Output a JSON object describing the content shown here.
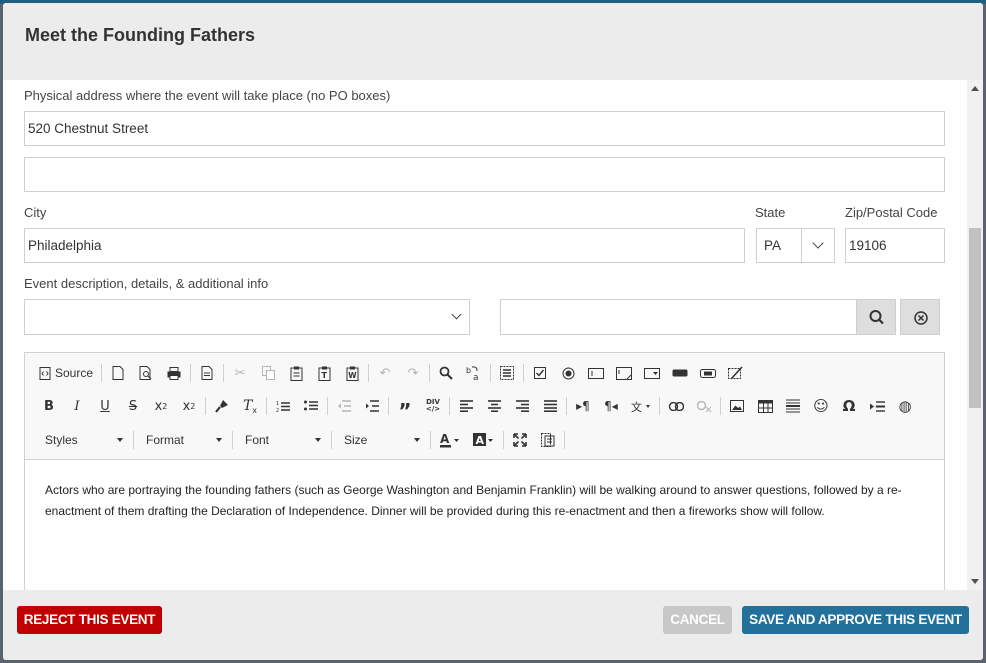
{
  "modal": {
    "title": "Meet the Founding Fathers"
  },
  "form": {
    "address_label": "Physical address where the event will take place (no PO boxes)",
    "address_line1": "520 Chestnut Street",
    "address_line2": "",
    "city_label": "City",
    "city": "Philadelphia",
    "state_label": "State",
    "state": "PA",
    "zip_label": "Zip/Postal Code",
    "zip": "19106",
    "description_label": "Event description, details, & additional info",
    "template_select": "",
    "search_value": ""
  },
  "editor": {
    "source_label": "Source",
    "combos": {
      "styles": "Styles",
      "format": "Format",
      "font": "Font",
      "size": "Size"
    },
    "content": "Actors who are portraying the founding fathers (such as George Washington and Benjamin Franklin) will be walking around to answer questions, followed by a re-enactment of them drafting the Declaration of Independence. Dinner will be provided during this re-enactment and then a fireworks show will follow."
  },
  "footer": {
    "reject_label": "REJECT THIS EVENT",
    "cancel_label": "CANCEL",
    "approve_label": "SAVE AND APPROVE THIS EVENT"
  },
  "colors": {
    "reject": "#c00000",
    "cancel": "#c8c8c8",
    "approve": "#23709b",
    "header": "#ececec"
  }
}
